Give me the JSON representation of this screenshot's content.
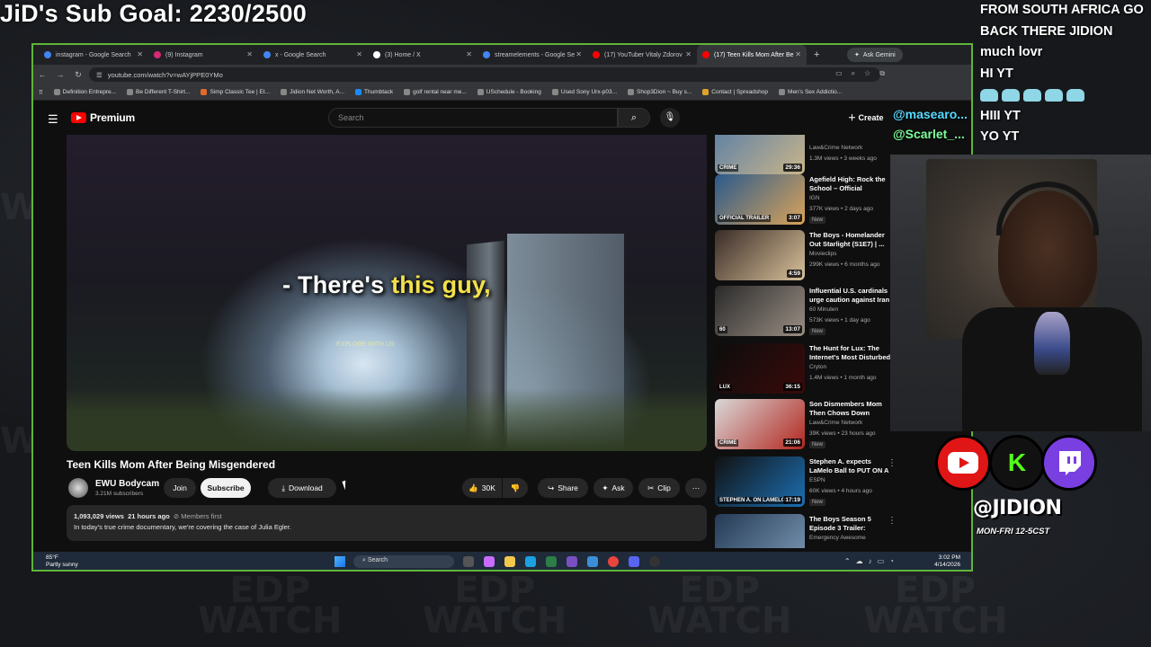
{
  "stream": {
    "sub_goal": "JiD's Sub Goal: 2230/2500",
    "chat": [
      "FROM SOUTH AFRICA GO",
      "BACK THERE JIDION",
      "much lovr",
      "HI YT",
      "",
      "HIII YT",
      "YO YT"
    ],
    "overlay_names": [
      "@masearo...",
      "@Scarlet_..."
    ],
    "handle": "@JIDION",
    "schedule": "MON-FRI 12-5CST",
    "socials": {
      "k_label": "K"
    }
  },
  "browser": {
    "tabs": [
      {
        "label": "instagram - Google Search",
        "color": "#4285f4"
      },
      {
        "label": "(9) Instagram",
        "color": "#d62976"
      },
      {
        "label": "x - Google Search",
        "color": "#4285f4"
      },
      {
        "label": "(3) Home / X",
        "color": "#ffffff"
      },
      {
        "label": "streamelements - Google Se",
        "color": "#4285f4"
      },
      {
        "label": "(17) YouTuber Vitaly Zdorov",
        "color": "#ff0000"
      },
      {
        "label": "(17) Teen Kills Mom After Be",
        "color": "#ff0000"
      }
    ],
    "gemini_label": "Ask Gemini",
    "url": "youtube.com/watch?v=wAYjPPE0YMo",
    "bookmarks": [
      "Definition Entrepre...",
      "Be Different T-Shirt...",
      "Simp Classic Tee | Et...",
      "Jidion Net Worth, A...",
      "Thumbtack",
      "golf rental near me...",
      "USchedule - Booking",
      "Used Sony Urx-p03...",
      "Shop3Dion ~ Buy s...",
      "Contact | Spreadshop",
      "Men's Sex Addictio..."
    ]
  },
  "youtube": {
    "brand": "Premium",
    "search_placeholder": "Search",
    "create_label": "Create",
    "caption_prefix": "- There's ",
    "caption_highlight": "this guy,",
    "player_watermark": "EXPLORE WITH US",
    "title": "Teen Kills Mom After Being Misgendered",
    "channel": "EWU Bodycam",
    "subscribers": "3.21M subscribers",
    "join_label": "Join",
    "subscribe_label": "Subscribe",
    "download_label": "Download",
    "likes": "30K",
    "share_label": "Share",
    "ask_label": "Ask",
    "clip_label": "Clip",
    "views": "1,093,029 views",
    "posted": "21 hours ago",
    "members_first": "Members first",
    "description": "In today's true crime documentary, we're covering the case of Julia Egler.",
    "recommendations": [
      {
        "title": "",
        "channel": "Law&Crime Network",
        "meta": "1.3M views • 3 weeks ago",
        "duration": "29:36",
        "new": "",
        "label": "CRIME",
        "c1": "#5b7fa6",
        "c2": "#c9b58a"
      },
      {
        "title": "Agefield High: Rock the School – Official Gameplay Overview",
        "channel": "IGN",
        "meta": "377K views • 2 days ago",
        "duration": "3:07",
        "new": "New",
        "label": "OFFICIAL TRAILER",
        "c1": "#2b5a8c",
        "c2": "#d9a35a"
      },
      {
        "title": "The Boys - Homelander Out Starlight (S1E7) | ...",
        "channel": "Movieclips",
        "meta": "299K views • 6 months ago",
        "duration": "4:59",
        "new": "",
        "label": "",
        "c1": "#3a2c27",
        "c2": "#d8c19a"
      },
      {
        "title": "Influential U.S. cardinals urge caution against Iran war",
        "channel": "60 Minuten",
        "meta": "573K views • 1 day ago",
        "duration": "13:07",
        "new": "New",
        "label": "60",
        "c1": "#2a2a2a",
        "c2": "#9a8e84"
      },
      {
        "title": "The Hunt for Lux: The Internet's Most Disturbed User",
        "channel": "Cryton",
        "meta": "1.4M views • 1 month ago",
        "duration": "36:15",
        "new": "",
        "label": "LUX",
        "c1": "#0d0d0d",
        "c2": "#3a0a0a"
      },
      {
        "title": "Son Dismembers Mom Then Chows Down Chick-fil-A",
        "channel": "Law&Crime Network",
        "meta": "39K views • 23 hours ago",
        "duration": "21:06",
        "new": "New",
        "label": "CRIME",
        "c1": "#d9d9d9",
        "c2": "#b3261e"
      },
      {
        "title": "Stephen A. expects LaMelo Ball to PUT ON A SHOW in the Hea...",
        "channel": "ESPN",
        "meta": "60K views • 4 hours ago",
        "duration": "17:19",
        "new": "New",
        "label": "STEPHEN A. ON LAMELO",
        "c1": "#111111",
        "c2": "#1c6fb3"
      },
      {
        "title": "The Boys Season 5 Episode 3 Trailer: Homelander Power ...",
        "channel": "Emergency Awesome",
        "meta": "",
        "duration": "",
        "new": "",
        "label": "BOYS",
        "c1": "#243a55",
        "c2": "#7a97b3"
      }
    ]
  },
  "taskbar": {
    "temp": "85°F",
    "weather": "Partly sunny",
    "search_label": "Search",
    "time": "3:02 PM",
    "date": "4/14/2026"
  },
  "colors": {
    "accent": "#5fb43a",
    "yt_red": "#ff0000",
    "caption_highlight": "#f3e04a"
  }
}
